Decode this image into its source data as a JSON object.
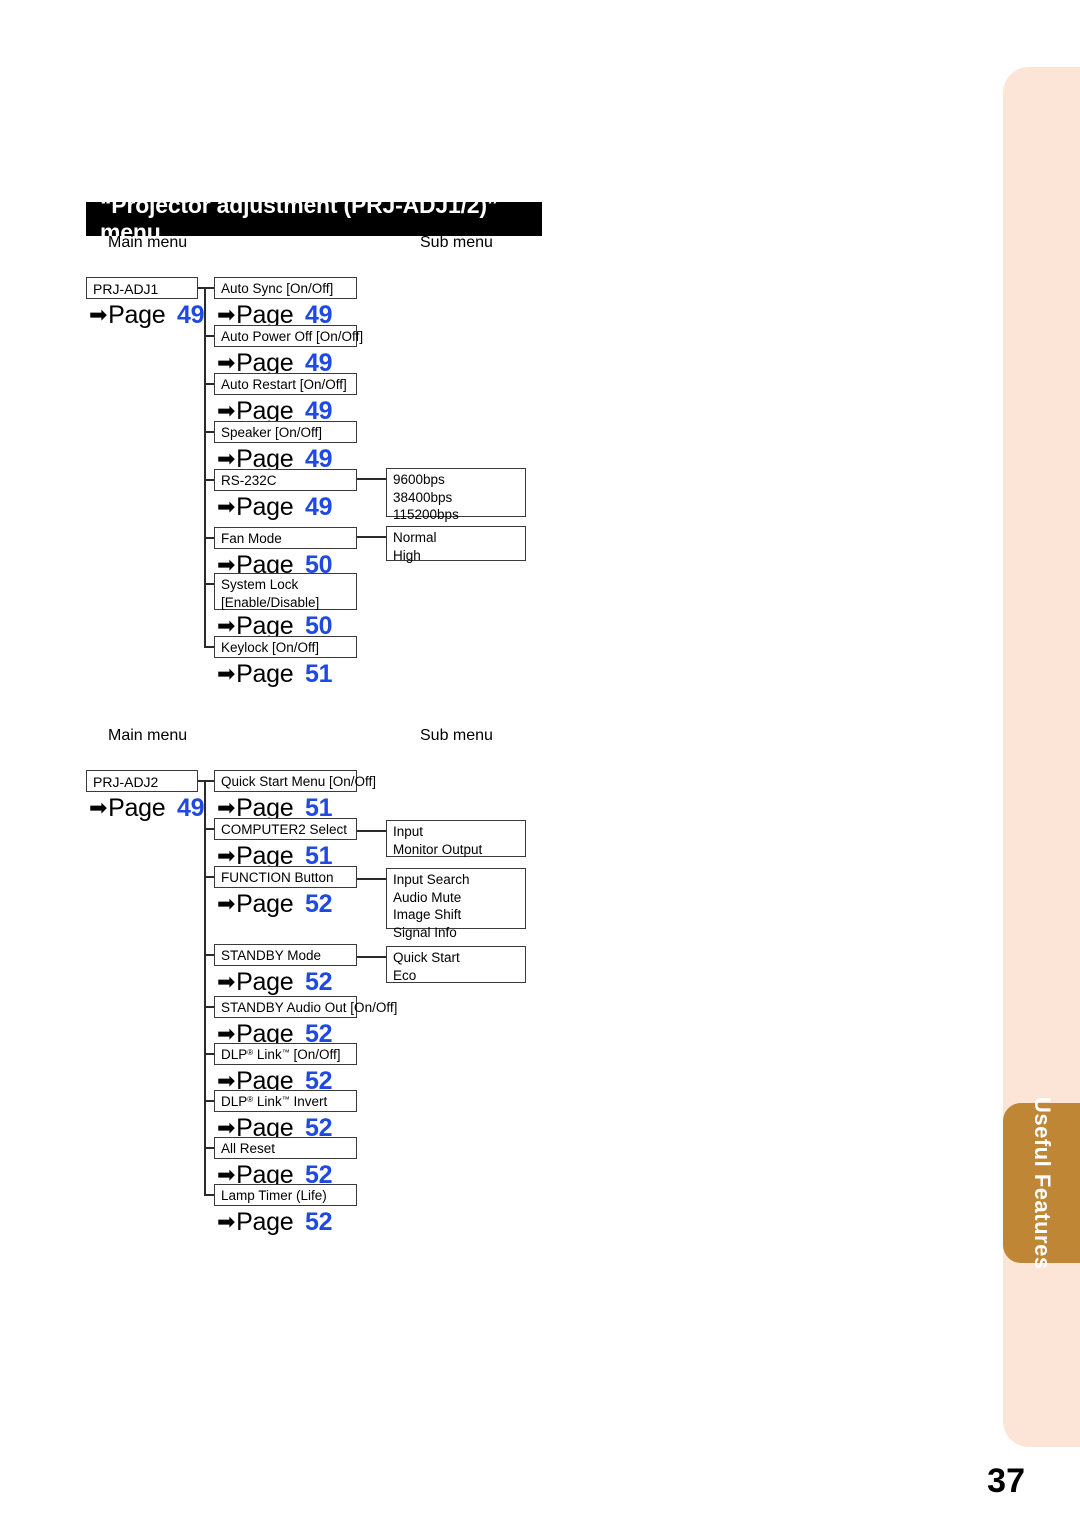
{
  "page": {
    "number": "37",
    "side_tab_label": "Useful Features",
    "accent_tab_color": "#bf8636",
    "accent_panel_color": "#fce4d6",
    "page_link_color": "#1f49e0"
  },
  "banner": {
    "title": "“Projector adjustment (PRJ-ADJ1/2)” menu"
  },
  "column_labels": {
    "main": "Main menu",
    "sub": "Sub menu"
  },
  "trees": [
    {
      "id": "prj-adj1",
      "main": {
        "label": "PRJ-ADJ1",
        "page": "49"
      },
      "items": [
        {
          "label": "Auto Sync [On/Off]",
          "page": "49",
          "sub": null
        },
        {
          "label": "Auto Power Off [On/Off]",
          "page": "49",
          "sub": null
        },
        {
          "label": "Auto Restart [On/Off]",
          "page": "49",
          "sub": null
        },
        {
          "label": "Speaker [On/Off]",
          "page": "49",
          "sub": null
        },
        {
          "label": "RS-232C",
          "page": "49",
          "sub": [
            "9600bps",
            "38400bps",
            "115200bps"
          ]
        },
        {
          "label": "Fan Mode",
          "page": "50",
          "sub": [
            "Normal",
            "High"
          ]
        },
        {
          "label": "System Lock\n[Enable/Disable]",
          "page": "50",
          "sub": null
        },
        {
          "label": "Keylock [On/Off]",
          "page": "51",
          "sub": null
        }
      ]
    },
    {
      "id": "prj-adj2",
      "main": {
        "label": "PRJ-ADJ2",
        "page": "49"
      },
      "items": [
        {
          "label": "Quick Start Menu [On/Off]",
          "page": "51",
          "sub": null
        },
        {
          "label": "COMPUTER2 Select",
          "page": "51",
          "sub": [
            "Input",
            "Monitor Output"
          ]
        },
        {
          "label": "FUNCTION Button",
          "page": "52",
          "sub": [
            "Input Search",
            "Audio Mute",
            "Image Shift",
            "Signal Info"
          ]
        },
        {
          "label": "STANDBY Mode",
          "page": "52",
          "sub": [
            "Quick Start",
            "Eco"
          ]
        },
        {
          "label": "STANDBY Audio Out [On/Off]",
          "page": "52",
          "sub": null
        },
        {
          "label": "DLP® Link™ [On/Off]",
          "page": "52",
          "sub": null
        },
        {
          "label": "DLP® Link™ Invert",
          "page": "52",
          "sub": null
        },
        {
          "label": "All Reset",
          "page": "52",
          "sub": null
        },
        {
          "label": "Lamp Timer (Life)",
          "page": "52",
          "sub": null
        }
      ]
    }
  ]
}
